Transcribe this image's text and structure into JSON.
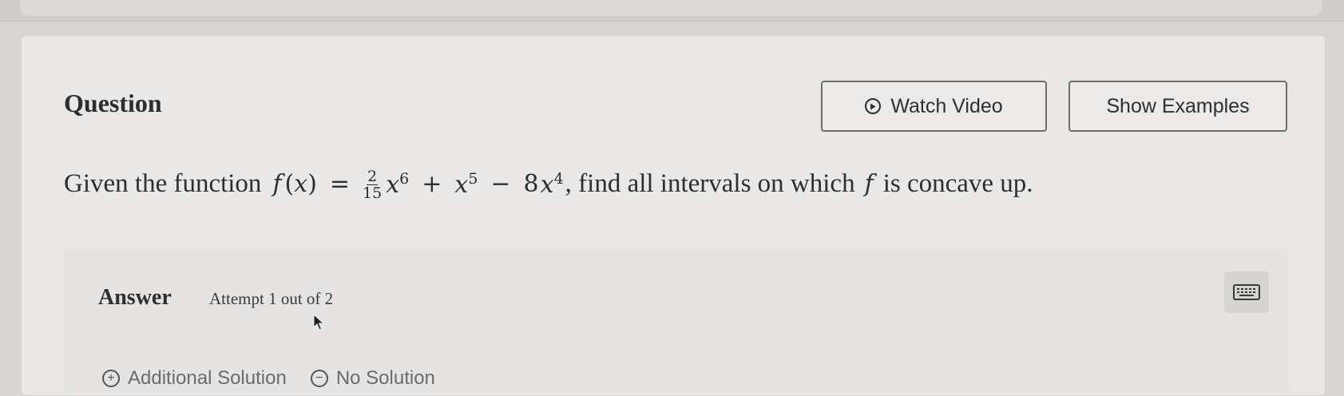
{
  "question": {
    "title": "Question",
    "watch_video_label": "Watch Video",
    "show_examples_label": "Show Examples",
    "text_before": "Given the function",
    "func_name": "f",
    "func_var": "(x)",
    "equals": "=",
    "frac_num": "2",
    "frac_den": "15",
    "term1": "x",
    "exp1": "6",
    "plus": "+",
    "term2": "x",
    "exp2": "5",
    "minus": "−",
    "coef3": "8",
    "term3": "x",
    "exp3": "4",
    "text_after": ", find all intervals on which",
    "func_ref": "f",
    "text_end": "is concave up."
  },
  "answer": {
    "label": "Answer",
    "attempt": "Attempt 1 out of 2",
    "options": {
      "additional_solution": "Additional Solution",
      "no_solution": "No Solution"
    }
  },
  "icons": {
    "video": "play-circle-icon",
    "keyboard": "keyboard-icon",
    "cursor": "mouse-pointer-icon"
  }
}
